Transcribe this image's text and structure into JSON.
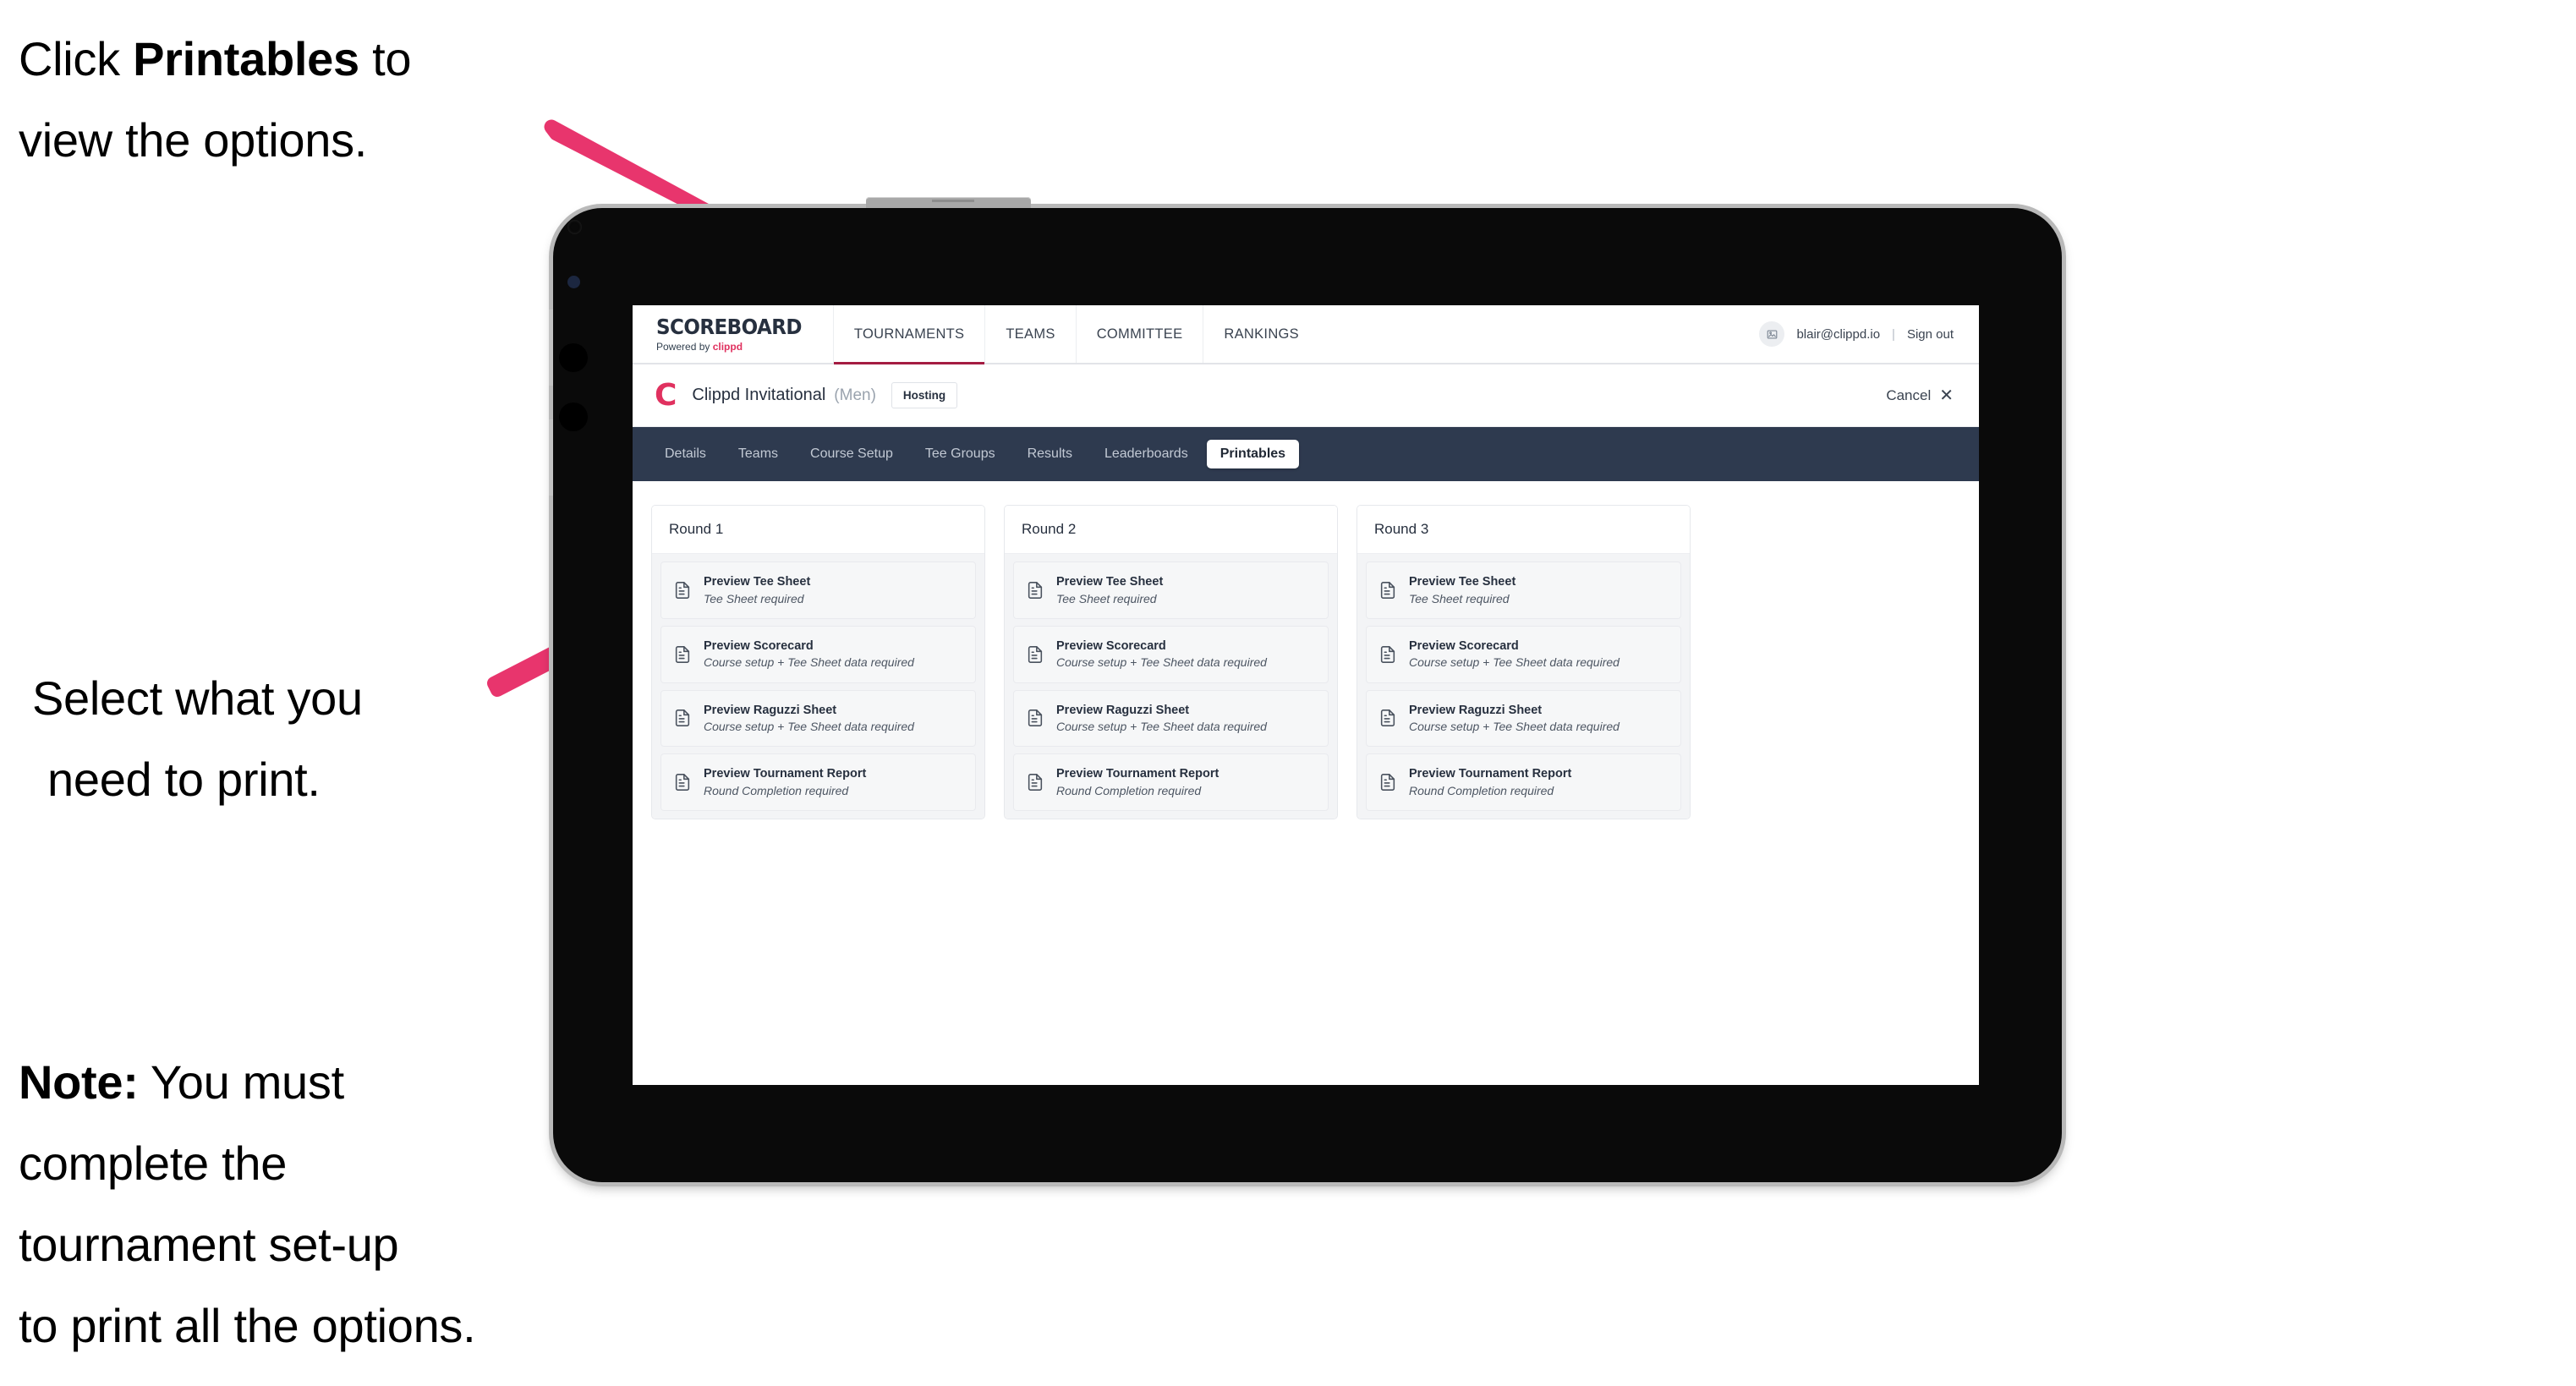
{
  "annotations": {
    "top": {
      "pre": "Click ",
      "bold": "Printables",
      "post": " to",
      "line2": "view the options."
    },
    "middle": {
      "line1": "Select what you",
      "line2": "need to print."
    },
    "bottom": {
      "bold": "Note:",
      "line1_rest": " You must",
      "line2": "complete the",
      "line3": "tournament set-up",
      "line4": "to print all the options."
    }
  },
  "colors": {
    "arrow": "#e8356d",
    "brand_accent": "#e0315f",
    "tabbar_bg": "#2e3a4f",
    "topnav_active_underline": "#a41c42",
    "device_frame": "#0a0a0a",
    "device_edge": "#b9b9b9"
  },
  "app": {
    "topnav": {
      "brand_title": "SCOREBOARD",
      "brand_sub_prefix": "Powered by ",
      "brand_sub_word": "clippd",
      "items": [
        {
          "label": "TOURNAMENTS",
          "active": true
        },
        {
          "label": "TEAMS",
          "active": false
        },
        {
          "label": "COMMITTEE",
          "active": false
        },
        {
          "label": "RANKINGS",
          "active": false
        }
      ],
      "avatar_icon": "user-avatar-icon",
      "user_email": "blair@clippd.io",
      "separator": "|",
      "sign_out": "Sign out"
    },
    "tournament_bar": {
      "logo_mark": "C",
      "name": "Clippd Invitational",
      "gender": "(Men)",
      "badge": "Hosting",
      "cancel_label": "Cancel",
      "cancel_icon": "✕"
    },
    "tabs": [
      {
        "label": "Details",
        "active": false
      },
      {
        "label": "Teams",
        "active": false
      },
      {
        "label": "Course Setup",
        "active": false
      },
      {
        "label": "Tee Groups",
        "active": false
      },
      {
        "label": "Results",
        "active": false
      },
      {
        "label": "Leaderboards",
        "active": false
      },
      {
        "label": "Printables",
        "active": true
      }
    ],
    "rounds": [
      {
        "title": "Round 1",
        "items": [
          {
            "title": "Preview Tee Sheet",
            "sub": "Tee Sheet required"
          },
          {
            "title": "Preview Scorecard",
            "sub": "Course setup + Tee Sheet data required"
          },
          {
            "title": "Preview Raguzzi Sheet",
            "sub": "Course setup + Tee Sheet data required"
          },
          {
            "title": "Preview Tournament Report",
            "sub": "Round Completion required"
          }
        ]
      },
      {
        "title": "Round 2",
        "items": [
          {
            "title": "Preview Tee Sheet",
            "sub": "Tee Sheet required"
          },
          {
            "title": "Preview Scorecard",
            "sub": "Course setup + Tee Sheet data required"
          },
          {
            "title": "Preview Raguzzi Sheet",
            "sub": "Course setup + Tee Sheet data required"
          },
          {
            "title": "Preview Tournament Report",
            "sub": "Round Completion required"
          }
        ]
      },
      {
        "title": "Round 3",
        "items": [
          {
            "title": "Preview Tee Sheet",
            "sub": "Tee Sheet required"
          },
          {
            "title": "Preview Scorecard",
            "sub": "Course setup + Tee Sheet data required"
          },
          {
            "title": "Preview Raguzzi Sheet",
            "sub": "Course setup + Tee Sheet data required"
          },
          {
            "title": "Preview Tournament Report",
            "sub": "Round Completion required"
          }
        ]
      }
    ]
  }
}
